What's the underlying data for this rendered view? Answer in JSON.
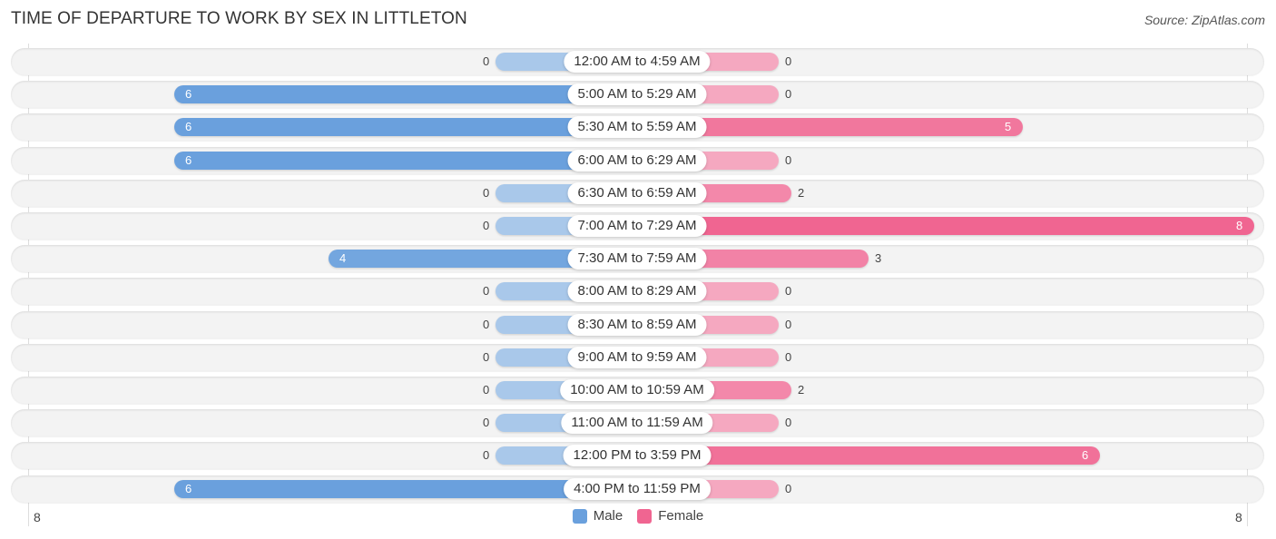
{
  "header": {
    "title": "TIME OF DEPARTURE TO WORK BY SEX IN LITTLETON",
    "source": "Source: ZipAtlas.com"
  },
  "colors": {
    "male_strong": "#6aa0dd",
    "male_weak": "#a9c8ea",
    "female_strong": "#f06591",
    "female_weak": "#f5a8c0"
  },
  "chart_data": {
    "type": "bar",
    "orientation": "horizontal-diverging",
    "title": "TIME OF DEPARTURE TO WORK BY SEX IN LITTLETON",
    "categories": [
      "12:00 AM to 4:59 AM",
      "5:00 AM to 5:29 AM",
      "5:30 AM to 5:59 AM",
      "6:00 AM to 6:29 AM",
      "6:30 AM to 6:59 AM",
      "7:00 AM to 7:29 AM",
      "7:30 AM to 7:59 AM",
      "8:00 AM to 8:29 AM",
      "8:30 AM to 8:59 AM",
      "9:00 AM to 9:59 AM",
      "10:00 AM to 10:59 AM",
      "11:00 AM to 11:59 AM",
      "12:00 PM to 3:59 PM",
      "4:00 PM to 11:59 PM"
    ],
    "series": [
      {
        "name": "Male",
        "values": [
          0,
          6,
          6,
          6,
          0,
          0,
          4,
          0,
          0,
          0,
          0,
          0,
          0,
          6
        ]
      },
      {
        "name": "Female",
        "values": [
          0,
          0,
          5,
          0,
          2,
          8,
          3,
          0,
          0,
          0,
          2,
          0,
          6,
          0
        ]
      }
    ],
    "axis": {
      "left_max": 8,
      "right_max": 8,
      "left_tick_label": "8",
      "right_tick_label": "8"
    },
    "legend": {
      "placement": "bottom-center",
      "entries": [
        "Male",
        "Female"
      ]
    },
    "xlabel": "",
    "ylabel": "",
    "grid": false
  }
}
